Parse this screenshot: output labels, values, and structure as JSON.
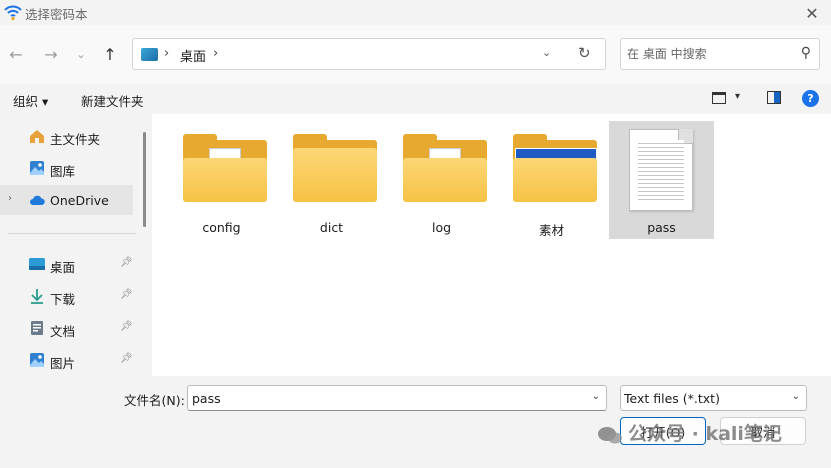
{
  "window": {
    "title": "选择密码本"
  },
  "navigation": {
    "breadcrumb": [
      "桌面"
    ],
    "search_placeholder": "在 桌面 中搜索"
  },
  "toolbar": {
    "organize": "组织 ▾",
    "new_folder": "新建文件夹"
  },
  "sidebar": {
    "items": [
      {
        "label": "主文件夹",
        "icon": "home-icon",
        "pinned": false
      },
      {
        "label": "图库",
        "icon": "gallery-icon",
        "pinned": false
      },
      {
        "label": "OneDrive",
        "icon": "cloud-icon",
        "pinned": false,
        "selected": true
      },
      {
        "label": "桌面",
        "icon": "desktop-icon",
        "pinned": true
      },
      {
        "label": "下载",
        "icon": "download-icon",
        "pinned": true
      },
      {
        "label": "文档",
        "icon": "document-icon",
        "pinned": true
      },
      {
        "label": "图片",
        "icon": "pictures-icon",
        "pinned": true
      }
    ]
  },
  "files": [
    {
      "name": "config",
      "type": "folder-with-document"
    },
    {
      "name": "dict",
      "type": "folder-empty"
    },
    {
      "name": "log",
      "type": "folder-with-document"
    },
    {
      "name": "素材",
      "type": "folder-with-image"
    },
    {
      "name": "pass",
      "type": "text-file",
      "selected": true
    }
  ],
  "footer": {
    "file_name_label": "文件名(N):",
    "file_name_value": "pass",
    "file_type": "Text files (*.txt)",
    "open_label": "打开(O)",
    "cancel_label": "取消"
  },
  "watermark": "公众号 · kali笔记",
  "colors": {
    "accent": "#0067c0",
    "folder": "#f6c244",
    "selection": "#d9d9d9"
  }
}
